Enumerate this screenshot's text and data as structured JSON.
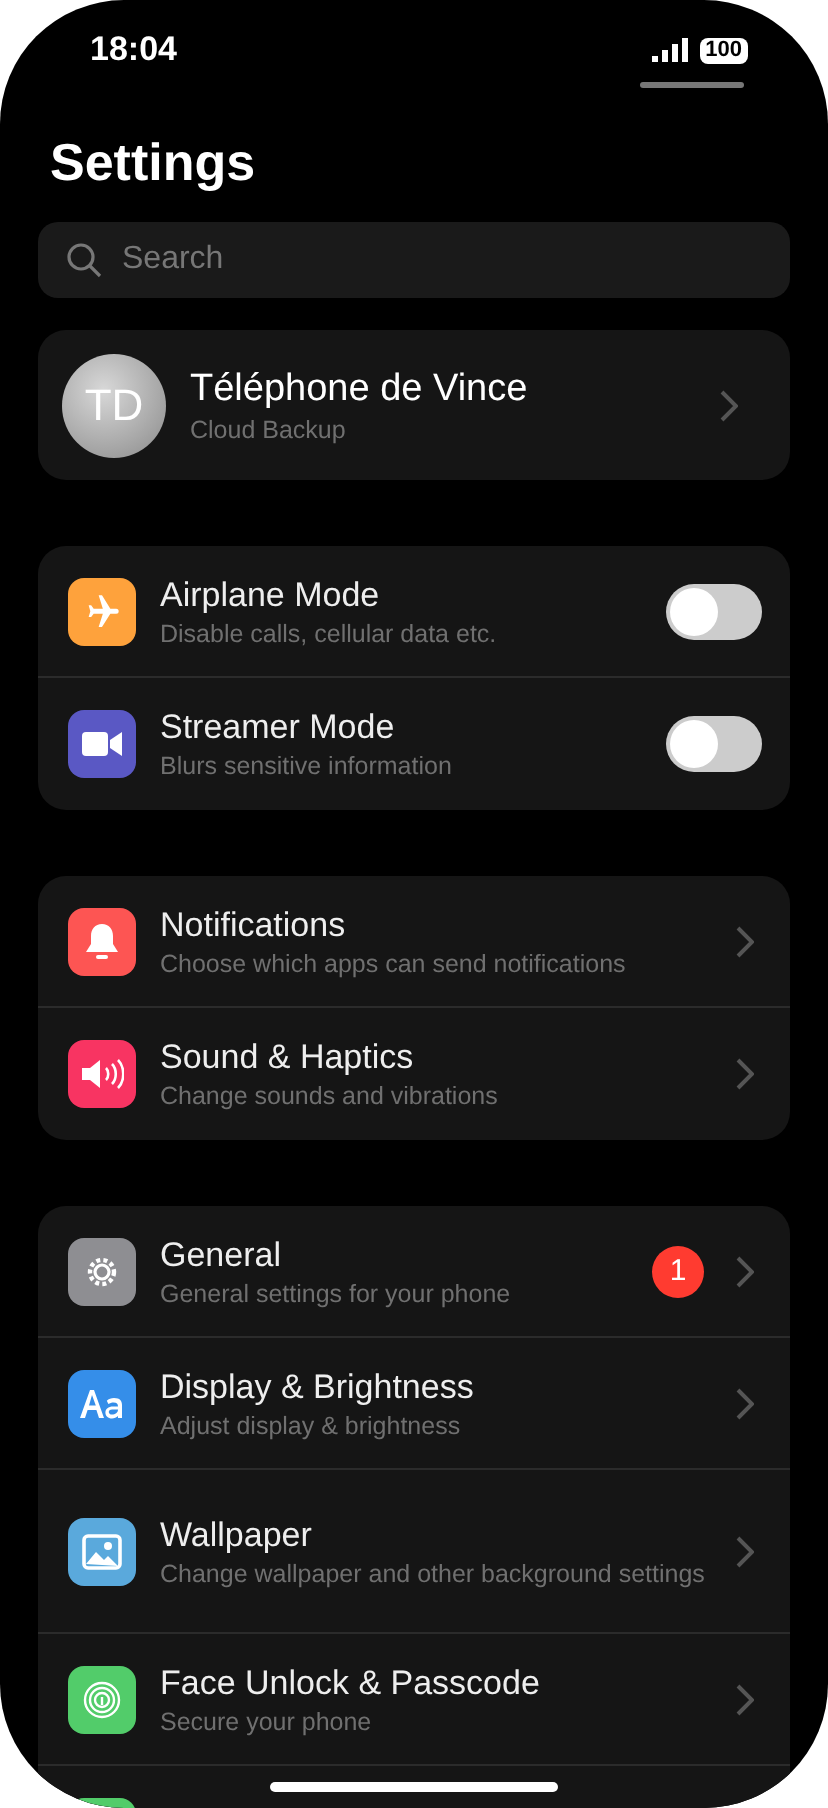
{
  "status_bar": {
    "time": "18:04",
    "battery": "100"
  },
  "title": "Settings",
  "search": {
    "placeholder": "Search"
  },
  "profile": {
    "initials": "TD",
    "name": "Téléphone de Vince",
    "subtitle": "Cloud Backup"
  },
  "groups": [
    {
      "rows": [
        {
          "kind": "toggle",
          "title": "Airplane Mode",
          "subtitle": "Disable calls, cellular data etc.",
          "color": "#fea23c",
          "on": false
        },
        {
          "kind": "toggle",
          "title": "Streamer Mode",
          "subtitle": "Blurs sensitive information",
          "color": "#5a58c4",
          "on": false
        }
      ]
    },
    {
      "rows": [
        {
          "kind": "link",
          "title": "Notifications",
          "subtitle": "Choose which apps can send notifications",
          "color": "#fd5553"
        },
        {
          "kind": "link",
          "title": "Sound & Haptics",
          "subtitle": "Change sounds and vibrations",
          "color": "#f83462"
        }
      ]
    },
    {
      "rows": [
        {
          "kind": "link",
          "title": "General",
          "subtitle": "General settings for your phone",
          "color": "#8e8e92",
          "badge": "1"
        },
        {
          "kind": "link",
          "title": "Display & Brightness",
          "subtitle": "Adjust display & brightness",
          "color": "#358ee9"
        },
        {
          "kind": "link",
          "title": "Wallpaper",
          "subtitle": "Change wallpaper and other background settings",
          "color": "#5aa9dc"
        },
        {
          "kind": "link",
          "title": "Face Unlock & Passcode",
          "subtitle": "Secure your phone",
          "color": "#52cc6a"
        },
        {
          "kind": "link",
          "color": "#52cc6a"
        }
      ]
    }
  ]
}
